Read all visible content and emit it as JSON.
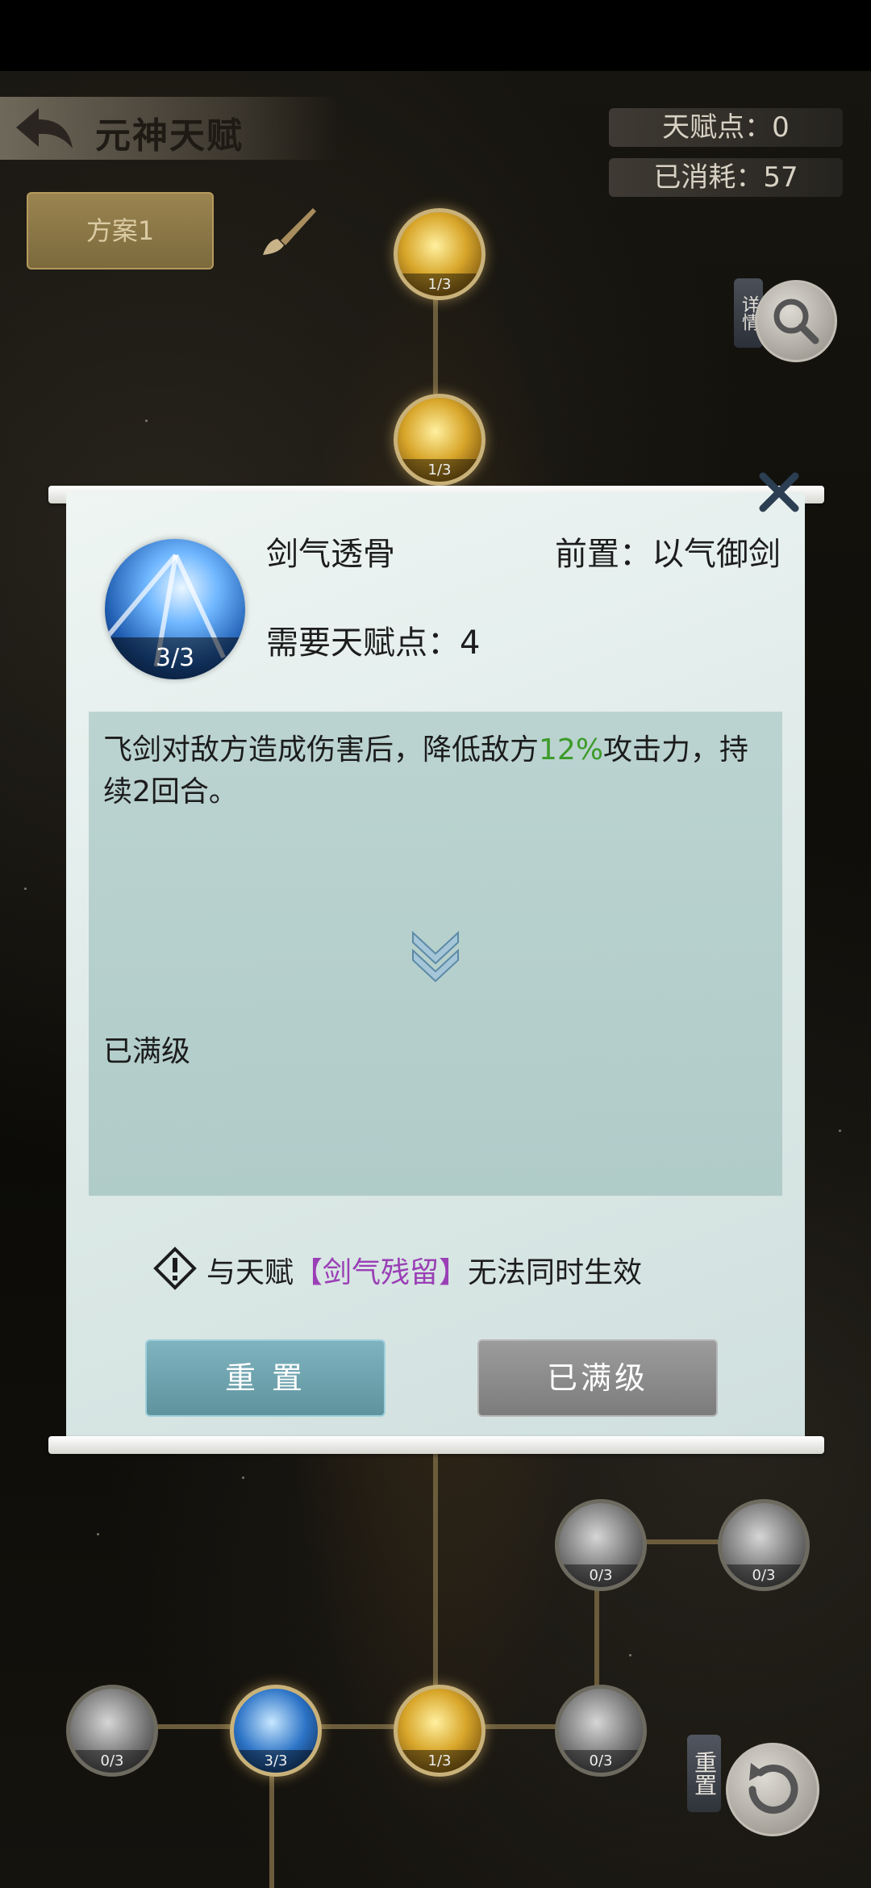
{
  "header": {
    "title": "元神天赋",
    "talent_points": "天赋点：0",
    "consumed": "已消耗：57",
    "plan_label": "方案1",
    "detail_label": "详情"
  },
  "tree_nodes_top": [
    {
      "level": "1/3"
    },
    {
      "level": "1/3"
    }
  ],
  "tree_nodes_bottom": [
    {
      "level": "0/3"
    },
    {
      "level": "0/3"
    },
    {
      "level": "0/3"
    },
    {
      "level": "3/3"
    },
    {
      "level": "1/3"
    },
    {
      "level": "0/3"
    }
  ],
  "dialog": {
    "skill_name": "剑气透骨",
    "skill_level": "3/3",
    "prerequisite": "前置：以气御剑",
    "cost": "需要天赋点：4",
    "desc_part1": "飞剑对敌方造成伤害后，降低敌方",
    "desc_highlight": "12%",
    "desc_part2": "攻击力，持续2回合。",
    "status": "已满级",
    "conflict_prefix": "与天赋",
    "conflict_name": "【剑气残留】",
    "conflict_suffix": "无法同时生效",
    "reset_button": "重 置",
    "maxed_button": "已满级"
  },
  "reset_tag": "重置",
  "colors": {
    "highlight": "#3d9b2a",
    "conflict": "#9a3fb5",
    "reset_button": "#6ea4af",
    "maxed_button": "#8c8c8c"
  }
}
